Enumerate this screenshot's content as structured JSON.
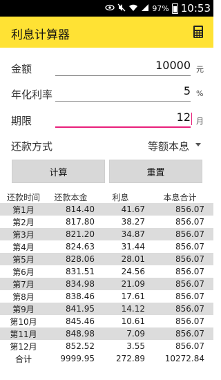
{
  "status_bar": {
    "battery": "97%",
    "time": "10:53"
  },
  "app": {
    "title": "利息计算器",
    "icon": "calculator-icon"
  },
  "form": {
    "amount": {
      "label": "金额",
      "value": "10000",
      "unit": "元"
    },
    "rate": {
      "label": "年化利率",
      "value": "5",
      "unit": "%"
    },
    "term": {
      "label": "期限",
      "value": "12",
      "unit": "月"
    },
    "method": {
      "label": "还款方式",
      "selected": "等额本息"
    }
  },
  "buttons": {
    "calculate": "计算",
    "reset": "重置"
  },
  "schedule": {
    "headers": [
      "还款时间",
      "还款本金",
      "利息",
      "本息合计"
    ],
    "rows": [
      [
        "第1月",
        "814.40",
        "41.67",
        "856.07"
      ],
      [
        "第2月",
        "817.80",
        "38.27",
        "856.07"
      ],
      [
        "第3月",
        "821.20",
        "34.87",
        "856.07"
      ],
      [
        "第4月",
        "824.63",
        "31.44",
        "856.07"
      ],
      [
        "第5月",
        "828.06",
        "28.01",
        "856.07"
      ],
      [
        "第6月",
        "831.51",
        "24.56",
        "856.07"
      ],
      [
        "第7月",
        "834.98",
        "21.09",
        "856.07"
      ],
      [
        "第8月",
        "838.46",
        "17.61",
        "856.07"
      ],
      [
        "第9月",
        "841.95",
        "14.12",
        "856.07"
      ],
      [
        "第10月",
        "845.46",
        "10.61",
        "856.07"
      ],
      [
        "第11月",
        "848.98",
        "7.09",
        "856.07"
      ],
      [
        "第12月",
        "852.52",
        "3.55",
        "856.07"
      ]
    ],
    "total": [
      "合计",
      "9999.95",
      "272.89",
      "10272.84"
    ]
  },
  "colors": {
    "appbar": "#ffe234",
    "focus_accent": "#e91e7a",
    "row_alt": "#dcdcdc"
  }
}
